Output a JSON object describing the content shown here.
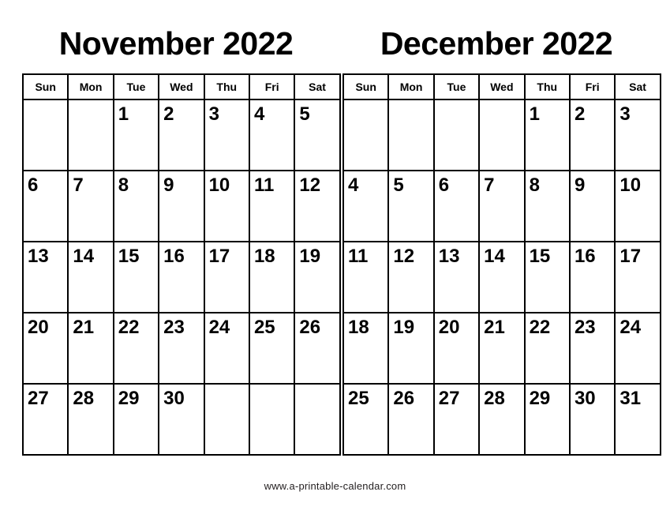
{
  "footer": {
    "url": "www.a-printable-calendar.com"
  },
  "weekdays": [
    "Sun",
    "Mon",
    "Tue",
    "Wed",
    "Thu",
    "Fri",
    "Sat"
  ],
  "months": [
    {
      "title": "November 2022",
      "name": "November",
      "year": "2022",
      "weeks": [
        [
          "",
          "",
          "1",
          "2",
          "3",
          "4",
          "5"
        ],
        [
          "6",
          "7",
          "8",
          "9",
          "10",
          "11",
          "12"
        ],
        [
          "13",
          "14",
          "15",
          "16",
          "17",
          "18",
          "19"
        ],
        [
          "20",
          "21",
          "22",
          "23",
          "24",
          "25",
          "26"
        ],
        [
          "27",
          "28",
          "29",
          "30",
          "",
          "",
          ""
        ]
      ]
    },
    {
      "title": "December 2022",
      "name": "December",
      "year": "2022",
      "weeks": [
        [
          "",
          "",
          "",
          "",
          "1",
          "2",
          "3"
        ],
        [
          "4",
          "5",
          "6",
          "7",
          "8",
          "9",
          "10"
        ],
        [
          "11",
          "12",
          "13",
          "14",
          "15",
          "16",
          "17"
        ],
        [
          "18",
          "19",
          "20",
          "21",
          "22",
          "23",
          "24"
        ],
        [
          "25",
          "26",
          "27",
          "28",
          "29",
          "30",
          "31"
        ]
      ]
    }
  ]
}
